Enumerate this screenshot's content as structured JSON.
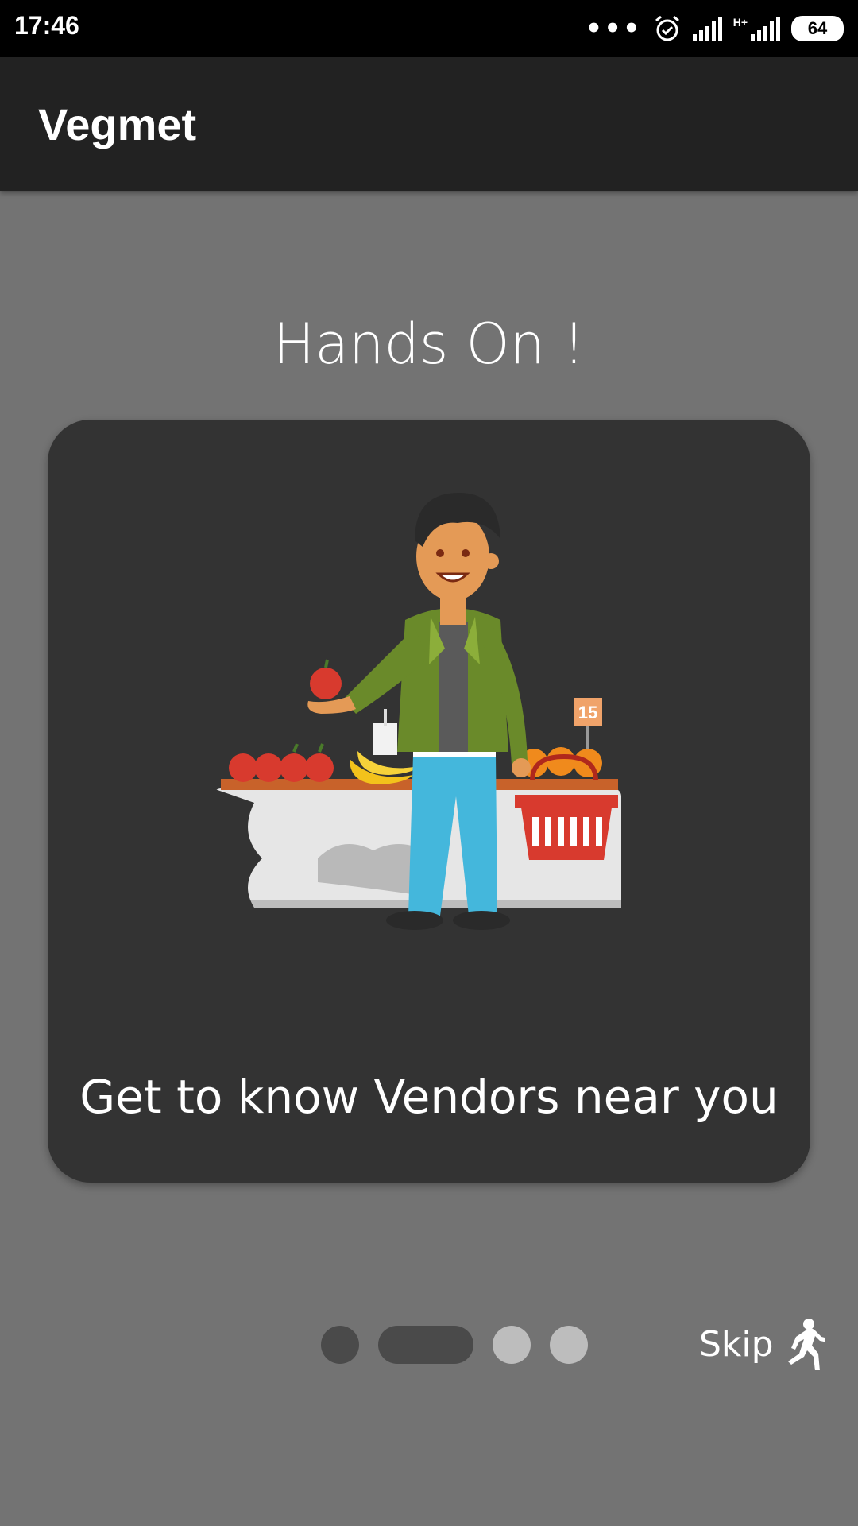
{
  "status_bar": {
    "time": "17:46",
    "more_icon": "more-dots-icon",
    "alarm_icon": "alarm-icon",
    "signal_icon": "signal-icon",
    "network_type": "H+",
    "battery": "64"
  },
  "app_bar": {
    "title": "Vegmet"
  },
  "onboarding": {
    "headline": "Hands On !",
    "caption": "Get to know Vendors near you",
    "illustration": "vendor-market-illustration",
    "price_tag": "15"
  },
  "indicators": [
    {
      "state": "inactive",
      "color": "#4a4a4a"
    },
    {
      "state": "active",
      "color": "#4a4a4a"
    },
    {
      "state": "inactive",
      "color": "#bdbdbd"
    },
    {
      "state": "inactive",
      "color": "#bdbdbd"
    }
  ],
  "skip": {
    "label": "Skip",
    "icon": "running-person-icon"
  },
  "colors": {
    "background": "#737373",
    "app_bar": "#222222",
    "card": "#333333"
  }
}
